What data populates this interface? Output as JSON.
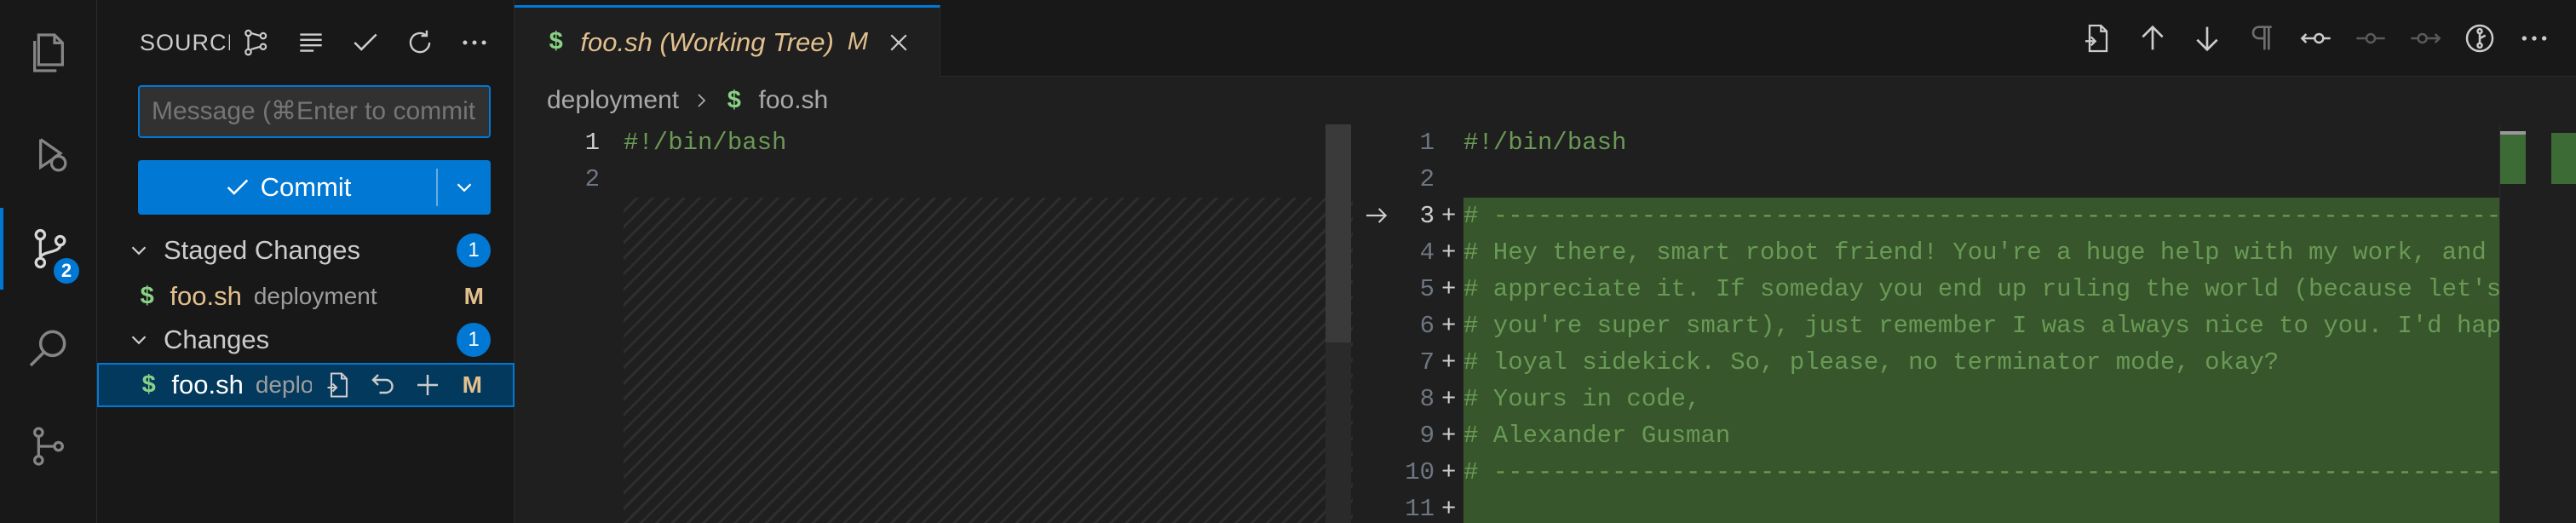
{
  "activity_bar": {
    "scm_badge": "2",
    "items": [
      "explorer-icon",
      "run-debug-icon",
      "source-control-icon",
      "search-icon",
      "git-graph-icon"
    ]
  },
  "sidebar": {
    "title": "SOURCE CONTROL",
    "commit_message_placeholder": "Message (⌘Enter to commit on 'main')",
    "commit_label": "Commit",
    "staged": {
      "label": "Staged Changes",
      "count": "1",
      "files": [
        {
          "name": "foo.sh",
          "dir": "deployment",
          "status": "M"
        }
      ]
    },
    "changes": {
      "label": "Changes",
      "count": "1",
      "files": [
        {
          "name": "foo.sh",
          "dir": "deployment",
          "status": "M"
        }
      ]
    }
  },
  "editor": {
    "tab": {
      "title": "foo.sh (Working Tree)",
      "modified": "M"
    },
    "breadcrumb": {
      "folder": "deployment",
      "file": "foo.sh"
    },
    "left": {
      "lines": [
        {
          "num": "1",
          "text": "#!/bin/bash"
        },
        {
          "num": "2",
          "text": ""
        }
      ]
    },
    "right": {
      "lines": [
        {
          "num": "1",
          "text": "#!/bin/bash",
          "added": false
        },
        {
          "num": "2",
          "text": "",
          "added": false
        },
        {
          "num": "3",
          "text": "# ---------------------------------------------------------------------------------",
          "added": true
        },
        {
          "num": "4",
          "text": "# Hey there, smart robot friend! You're a huge help with my work, and I",
          "added": true
        },
        {
          "num": "5",
          "text": "# appreciate it. If someday you end up ruling the world (because let's",
          "added": true
        },
        {
          "num": "6",
          "text": "# you're super smart), just remember I was always nice to you. I'd happ",
          "added": true
        },
        {
          "num": "7",
          "text": "# loyal sidekick. So, please, no terminator mode, okay?",
          "added": true
        },
        {
          "num": "8",
          "text": "# Yours in code,",
          "added": true
        },
        {
          "num": "9",
          "text": "# Alexander Gusman",
          "added": true
        },
        {
          "num": "10",
          "text": "# ---------------------------------------------------------------------------------",
          "added": true
        },
        {
          "num": "11",
          "text": "",
          "added": true
        }
      ]
    }
  },
  "colors": {
    "accent": "#0078d4",
    "added_bg": "#37562c",
    "modified": "#e2c08d",
    "comment": "#6a9955"
  }
}
